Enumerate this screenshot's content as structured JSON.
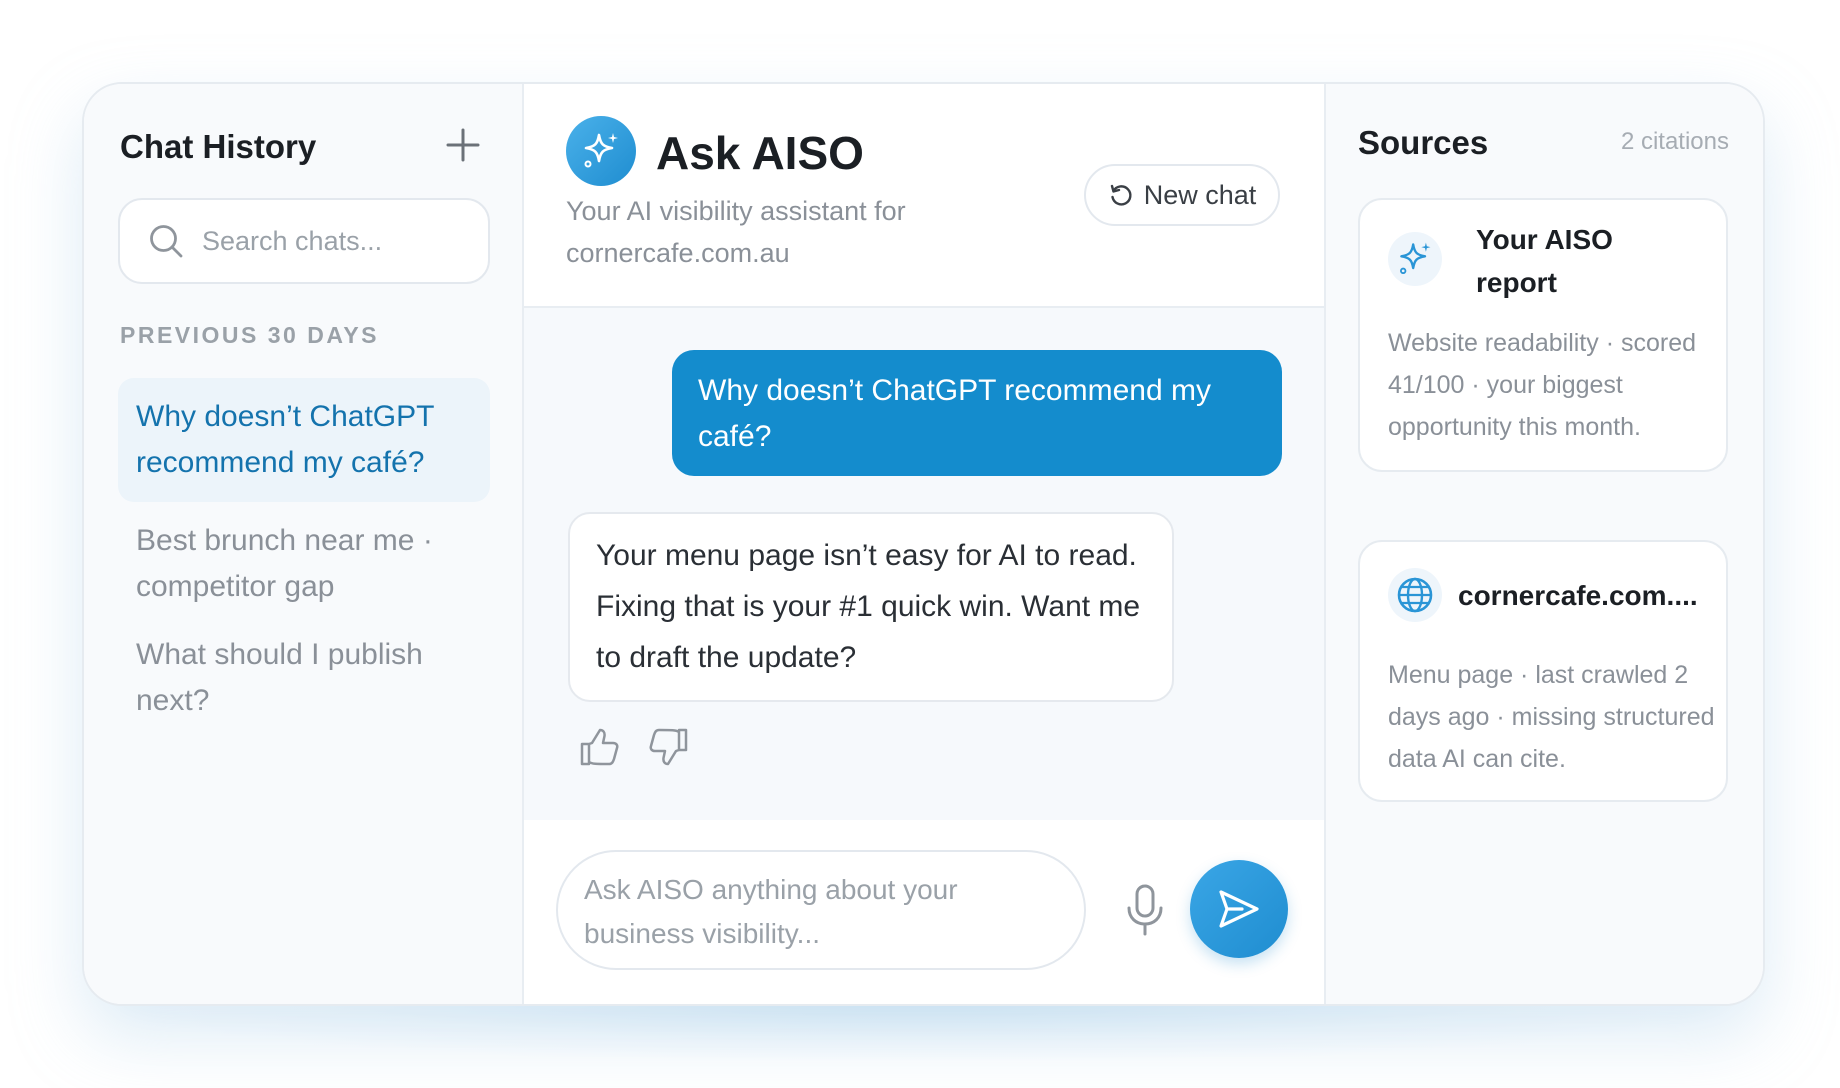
{
  "sidebar": {
    "title": "Chat History",
    "search_placeholder": "Search chats...",
    "section_label": "PREVIOUS 30 DAYS",
    "items": [
      {
        "label": "Why doesn’t ChatGPT recommend my café?",
        "active": true
      },
      {
        "label": "Best brunch near me · competitor gap",
        "active": false
      },
      {
        "label": "What should I publish next?",
        "active": false
      }
    ]
  },
  "main": {
    "title": "Ask AISO",
    "subtitle": "Your AI visibility assistant for cornercafe.com.au",
    "new_chat_label": "New chat",
    "messages": {
      "user": "Why doesn’t ChatGPT recommend my café?",
      "assistant": "Your menu page isn’t easy for AI to read. Fixing that is your #1 quick win. Want me to draft the update?"
    },
    "composer_placeholder": "Ask AISO anything about your business visibility..."
  },
  "sources": {
    "title": "Sources",
    "count": "2 citations",
    "cards": [
      {
        "icon": "sparkle-icon",
        "title": "Your AISO report",
        "body": "Website readability · scored 41/100 · your biggest opportunity this month."
      },
      {
        "icon": "globe-icon",
        "title": "cornercafe.com....",
        "body": "Menu page · last crawled 2 days ago · missing structured data AI can cite."
      }
    ]
  },
  "colors": {
    "accent": "#148ccd",
    "active_bg": "#ecf4fa",
    "active_text": "#1473ad"
  }
}
